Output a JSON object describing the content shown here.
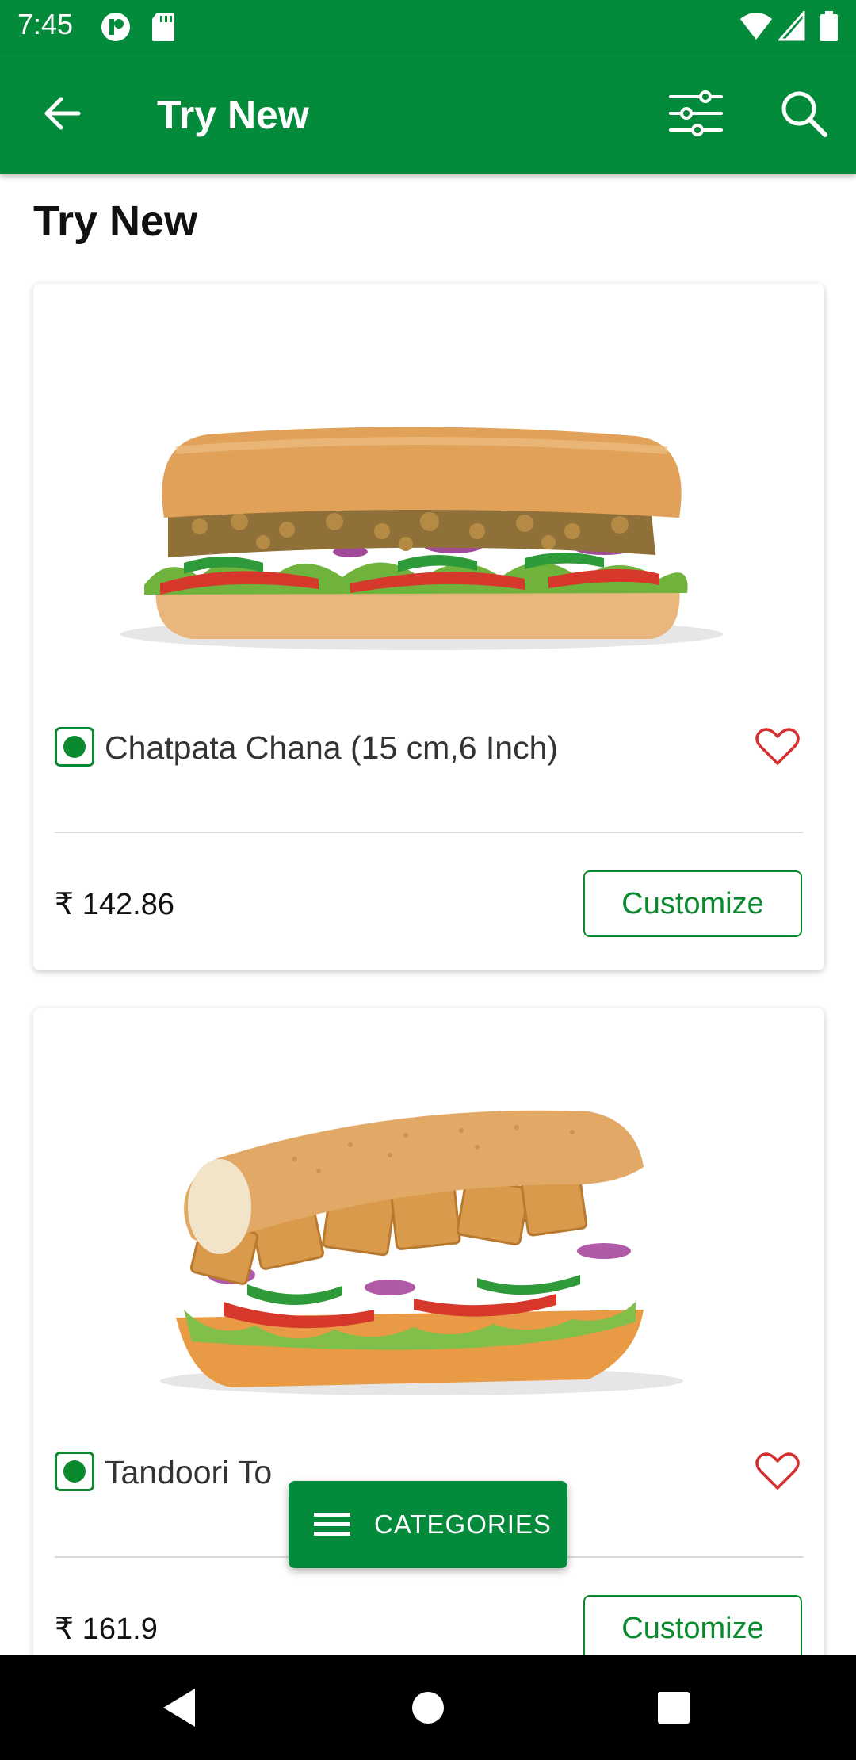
{
  "status_bar": {
    "time": "7:45"
  },
  "app_bar": {
    "title": "Try New"
  },
  "page": {
    "heading": "Try New"
  },
  "items": [
    {
      "name": "Chatpata Chana  (15 cm,6 Inch)",
      "price": "₹ 142.86",
      "customize_label": "Customize",
      "veg": true
    },
    {
      "name": "Tandoori To",
      "price": "₹ 161.9",
      "customize_label": "Customize",
      "veg": true
    }
  ],
  "fab": {
    "label": "CATEGORIES"
  },
  "colors": {
    "brand_green": "#038a3a",
    "veg_green": "#0a8a2e",
    "heart_red": "#d32f2f"
  },
  "icons": [
    "back-arrow-icon",
    "filter-sliders-icon",
    "search-icon",
    "heart-outline-icon",
    "menu-icon",
    "nav-back-icon",
    "nav-home-icon",
    "nav-recents-icon"
  ]
}
